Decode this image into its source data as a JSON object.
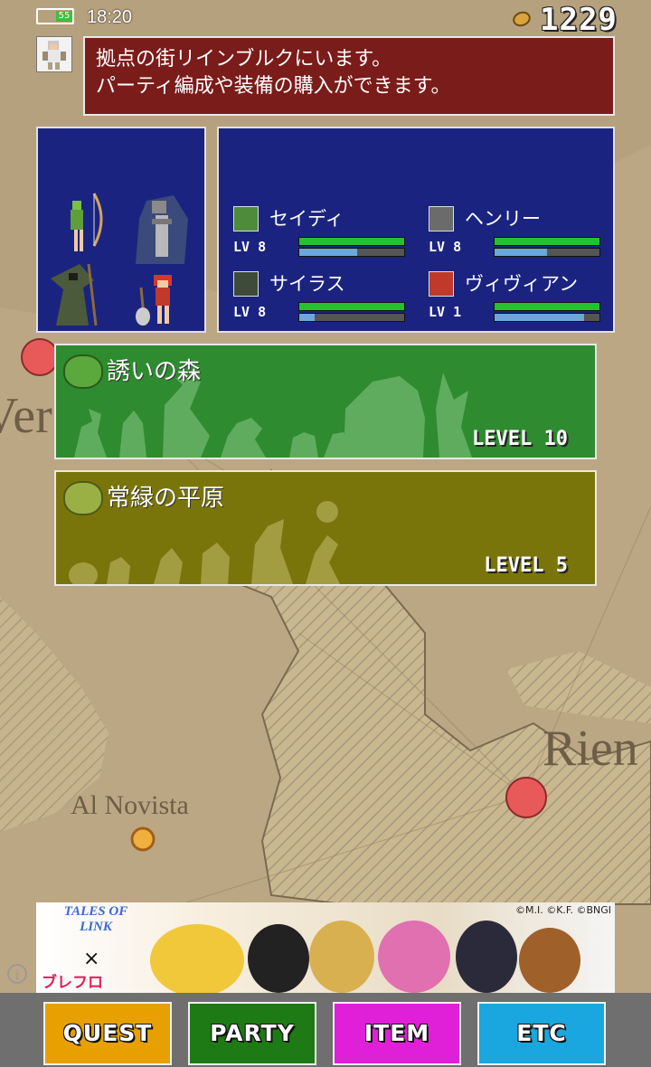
{
  "status_bar": {
    "time": "18:20",
    "battery": "55"
  },
  "header": {
    "coin_icon": "gold-coin-icon",
    "coins": "1229"
  },
  "message": {
    "lines": [
      "拠点の街リインブルクにいます。",
      "パーティ編成や装備の購入ができます。"
    ]
  },
  "map": {
    "labels": [
      "Al Novista",
      "Rien",
      "Ver"
    ]
  },
  "party": {
    "members": [
      {
        "name": "セイディ",
        "level": "LV 8",
        "hp": 1.0,
        "xp": 0.55,
        "face_color": "#4e8b3a"
      },
      {
        "name": "ヘンリー",
        "level": "LV 8",
        "hp": 1.0,
        "xp": 0.5,
        "face_color": "#6b6b6b"
      },
      {
        "name": "サイラス",
        "level": "LV 8",
        "hp": 1.0,
        "xp": 0.15,
        "face_color": "#3e4a3a"
      },
      {
        "name": "ヴィヴィアン",
        "level": "LV 1",
        "hp": 1.0,
        "xp": 0.85,
        "face_color": "#c0392b"
      }
    ]
  },
  "quests": [
    {
      "name": "誘いの森",
      "level": "LEVEL 10",
      "color": "#2f8b2f",
      "icon": "dragon-icon"
    },
    {
      "name": "常緑の平原",
      "level": "LEVEL 5",
      "color": "#7a750a",
      "icon": "grass-field-icon"
    }
  ],
  "ad": {
    "logo": "TALES OF LINK",
    "cross": "×",
    "partner": "ブレフロ",
    "copyright": "©M.I. ©K.F. ©BNGI"
  },
  "nav": [
    {
      "label": "QUEST",
      "color": "#e8a000"
    },
    {
      "label": "PARTY",
      "color": "#1e7a14"
    },
    {
      "label": "ITEM",
      "color": "#e020d8"
    },
    {
      "label": "ETC",
      "color": "#1aa6de"
    }
  ]
}
